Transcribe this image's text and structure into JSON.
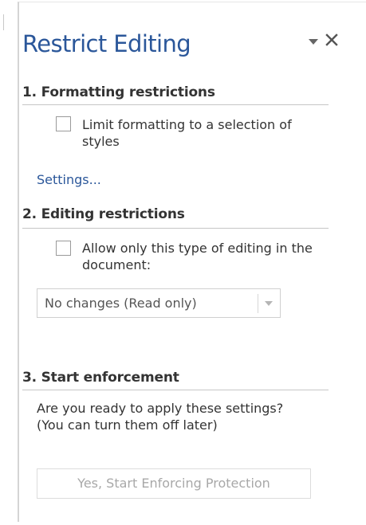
{
  "pane": {
    "title": "Restrict Editing",
    "menu_icon": "chevron-down-icon",
    "close_icon": "close-icon"
  },
  "formatting": {
    "heading": "1. Formatting restrictions",
    "checkbox_label": "Limit formatting to a selection of styles",
    "checked": false,
    "settings_link": "Settings..."
  },
  "editing": {
    "heading": "2. Editing restrictions",
    "checkbox_label": "Allow only this type of editing in the document:",
    "checked": false,
    "selected_option": "No changes (Read only)"
  },
  "enforcement": {
    "heading": "3. Start enforcement",
    "description": "Are you ready to apply these settings? (You can turn them off later)",
    "button_label": "Yes, Start Enforcing Protection",
    "button_enabled": false
  },
  "colors": {
    "accent": "#2b579a",
    "text": "#333333",
    "disabled_text": "#a8a8a8",
    "rule": "#c6c6c6"
  }
}
